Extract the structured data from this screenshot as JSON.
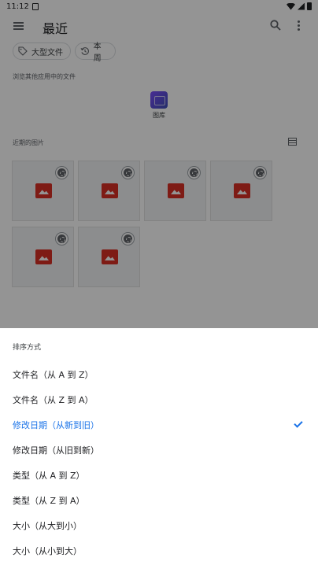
{
  "status_bar": {
    "time": "11:12"
  },
  "app_bar": {
    "title": "最近"
  },
  "chips": [
    {
      "label": "大型文件",
      "icon": "tag-icon"
    },
    {
      "label": "本周",
      "icon": "history-icon"
    }
  ],
  "sections": {
    "other_apps_label": "浏览其他应用中的文件",
    "recent_images_label": "近期的图片"
  },
  "apps": [
    {
      "label": "图库",
      "icon": "gallery-icon"
    }
  ],
  "thumbnails": {
    "count": 6,
    "icon": "image-icon"
  },
  "sort_sheet": {
    "title": "排序方式",
    "options": [
      {
        "label": "文件名（从 A 到 Z）",
        "selected": false
      },
      {
        "label": "文件名（从 Z 到 A）",
        "selected": false
      },
      {
        "label": "修改日期（从新到旧）",
        "selected": true
      },
      {
        "label": "修改日期（从旧到新）",
        "selected": false
      },
      {
        "label": "类型（从 A 到 Z）",
        "selected": false
      },
      {
        "label": "类型（从 Z 到 A）",
        "selected": false
      },
      {
        "label": "大小（从大到小）",
        "selected": false
      },
      {
        "label": "大小（从小到大）",
        "selected": false
      }
    ]
  },
  "colors": {
    "accent": "#1a73e8",
    "scrim": "rgba(0,0,0,0.42)",
    "image_placeholder": "#d93025"
  }
}
